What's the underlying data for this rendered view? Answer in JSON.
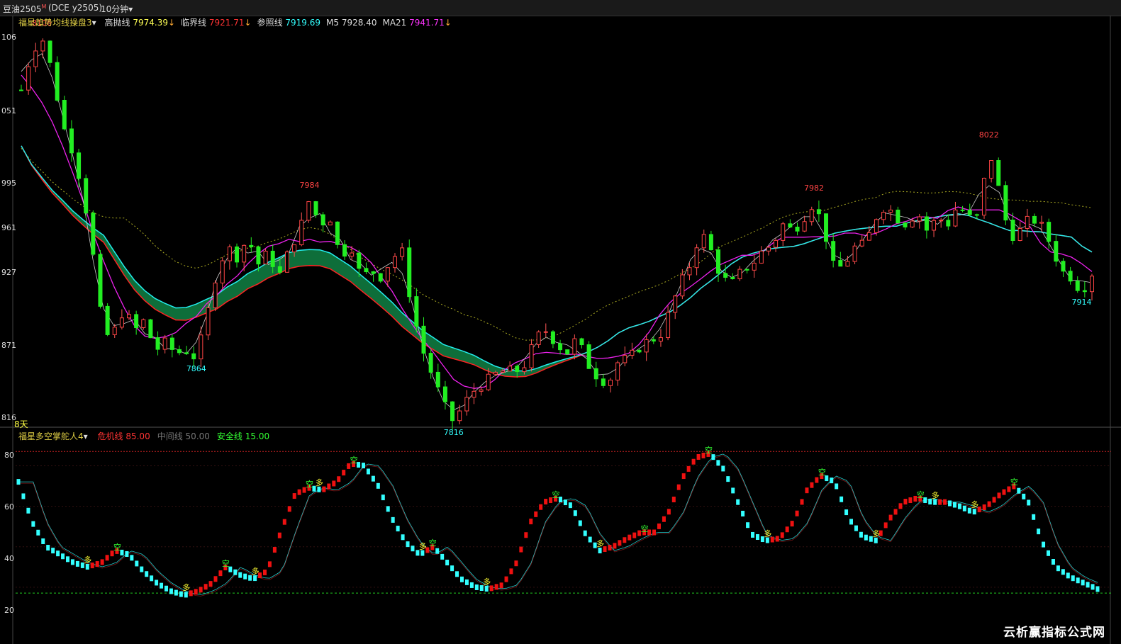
{
  "header": {
    "symbol": "豆油2505",
    "symbol_sup": "M",
    "contract": "(DCE y2505)",
    "period": "10分钟",
    "chevron": "▾"
  },
  "main_indicators": {
    "name": "福星趋势均线操盘3",
    "chevron": "▾",
    "items": [
      {
        "label": "高抛线",
        "value": "7974.39",
        "color": "#ffff55",
        "arrow": "↓"
      },
      {
        "label": "临界线",
        "value": "7921.71",
        "color": "#ff3333",
        "arrow": "↓"
      },
      {
        "label": "参照线",
        "value": "7919.69",
        "color": "#33ffff",
        "arrow": ""
      },
      {
        "label": "M5",
        "value": "7928.40",
        "color": "#dddddd",
        "arrow": ""
      },
      {
        "label": "MA21",
        "value": "7941.71",
        "color": "#ff33ff",
        "arrow": "↓"
      }
    ]
  },
  "sub_indicators": {
    "name": "福星多空掌舵人4",
    "chevron": "▾",
    "items": [
      {
        "label": "危机线",
        "value": "85.00",
        "color": "#ff3333"
      },
      {
        "label": "中间线",
        "value": "50.00",
        "color": "#777777"
      },
      {
        "label": "安全线",
        "value": "15.00",
        "color": "#33ff33"
      }
    ]
  },
  "days_label": "8天",
  "price_annotations": [
    {
      "text": "8106",
      "color": "#ff4444"
    },
    {
      "text": "7864",
      "color": "#33ffff"
    },
    {
      "text": "7984",
      "color": "#ff4444"
    },
    {
      "text": "7816",
      "color": "#33ffff"
    },
    {
      "text": "7982",
      "color": "#ff4444"
    },
    {
      "text": "8022",
      "color": "#ff4444"
    },
    {
      "text": "7914",
      "color": "#33ffff"
    }
  ],
  "signal_labels": {
    "long": "多",
    "short": "空"
  },
  "watermark": "云析赢指标公式网",
  "chart_data": [
    {
      "type": "candlestick",
      "yticks": [
        "106",
        "051",
        "995",
        "961",
        "927",
        "871",
        "816"
      ],
      "ylim": [
        7816,
        8106
      ],
      "series": [
        {
          "name": "高抛线",
          "color": "#cccc33",
          "style": "dotted"
        },
        {
          "name": "临界线",
          "color": "#ff2222"
        },
        {
          "name": "参照线",
          "color": "#22eeee"
        },
        {
          "name": "M5",
          "color": "#cccccc"
        },
        {
          "name": "MA21",
          "color": "#ee22ee"
        }
      ],
      "path_points": [
        8066,
        8094,
        8106,
        8080,
        8040,
        8020,
        7990,
        7940,
        7880,
        7884,
        7902,
        7885,
        7893,
        7870,
        7876,
        7868,
        7870,
        7864,
        7895,
        7930,
        7948,
        7940,
        7955,
        7935,
        7944,
        7925,
        7945,
        7960,
        7984,
        7965,
        7970,
        7940,
        7950,
        7925,
        7930,
        7925,
        7940,
        7944,
        7900,
        7870,
        7850,
        7830,
        7816,
        7830,
        7840,
        7846,
        7852,
        7855,
        7854,
        7860,
        7880,
        7885,
        7875,
        7868,
        7880,
        7860,
        7850,
        7845,
        7862,
        7864,
        7872,
        7878,
        7880,
        7900,
        7920,
        7935,
        7960,
        7945,
        7925,
        7920,
        7930,
        7935,
        7945,
        7950,
        7965,
        7960,
        7970,
        7982,
        7960,
        7930,
        7935,
        7948,
        7950,
        7970,
        7980,
        7970,
        7965,
        7975,
        7960,
        7970,
        7965,
        7980,
        7970,
        7970,
        8022,
        7990,
        7955,
        7960,
        7970,
        7965,
        7950,
        7930,
        7925,
        7914,
        7928
      ]
    },
    {
      "type": "line",
      "yticks": [
        "80",
        "60",
        "40",
        "20"
      ],
      "ylim": [
        0,
        90
      ],
      "reference_lines": [
        {
          "name": "危机线",
          "value": 85
        },
        {
          "name": "中间线",
          "value": 50
        },
        {
          "name": "安全线",
          "value": 15
        }
      ],
      "osc_points": [
        70,
        50,
        38,
        34,
        30,
        28,
        30,
        36,
        34,
        26,
        20,
        16,
        14,
        16,
        20,
        28,
        24,
        22,
        26,
        46,
        64,
        67,
        66,
        70,
        79,
        78,
        68,
        52,
        40,
        34,
        38,
        30,
        22,
        18,
        17,
        19,
        30,
        50,
        60,
        62,
        58,
        44,
        36,
        38,
        42,
        45,
        45,
        55,
        72,
        82,
        84,
        76,
        60,
        44,
        41,
        42,
        50,
        66,
        73,
        70,
        52,
        43,
        41,
        52,
        60,
        62,
        60,
        60,
        58,
        55,
        58,
        64,
        68,
        60,
        40,
        28,
        23,
        20,
        17
      ]
    }
  ]
}
